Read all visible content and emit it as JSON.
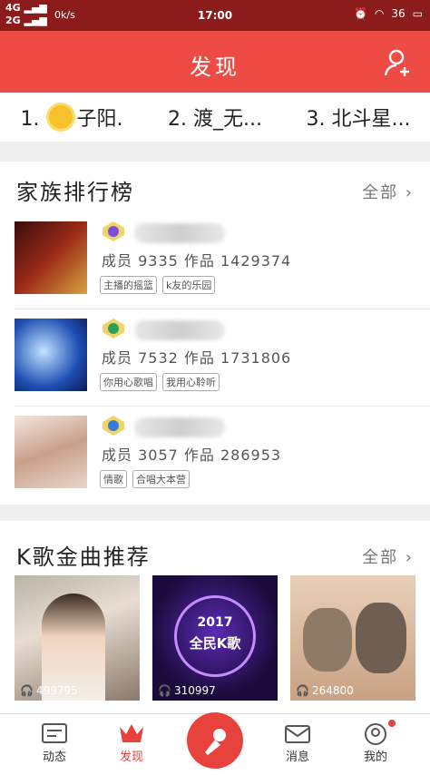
{
  "status_bar": {
    "net1": "4G",
    "net2": "2G",
    "speed": "0k/s",
    "time": "17:00",
    "battery": "36"
  },
  "header": {
    "title": "发现"
  },
  "top_names": [
    "1. ",
    "子阳.",
    "2. 渡_无...",
    "3. 北斗星..."
  ],
  "family": {
    "title": "家族排行榜",
    "all_label": "全部 ›",
    "rows": [
      {
        "stats": "成员 9335 作品 1429374",
        "tags": [
          "主播的摇篮",
          "k友的乐园"
        ],
        "badge_color": "#7b4fd6"
      },
      {
        "stats": "成员 7532 作品 1731806",
        "tags": [
          "你用心歌唱",
          "我用心聆听"
        ],
        "badge_color": "#2e9e5b"
      },
      {
        "stats": "成员 3057 作品 286953",
        "tags": [
          "情歌",
          "合唱大本营"
        ],
        "badge_color": "#3a7bd5"
      }
    ]
  },
  "songs": {
    "title": "K歌金曲推荐",
    "all_label": "全部 ›",
    "items": [
      {
        "plays": "499795"
      },
      {
        "plays": "310997",
        "cover_text": "2017",
        "cover_text2": "全民K歌"
      },
      {
        "plays": "264800"
      }
    ]
  },
  "tabbar": {
    "feed": "动态",
    "discover": "发现",
    "messages": "消息",
    "me": "我的"
  },
  "colors": {
    "brand": "#ee4b45",
    "active": "#e8423c"
  }
}
